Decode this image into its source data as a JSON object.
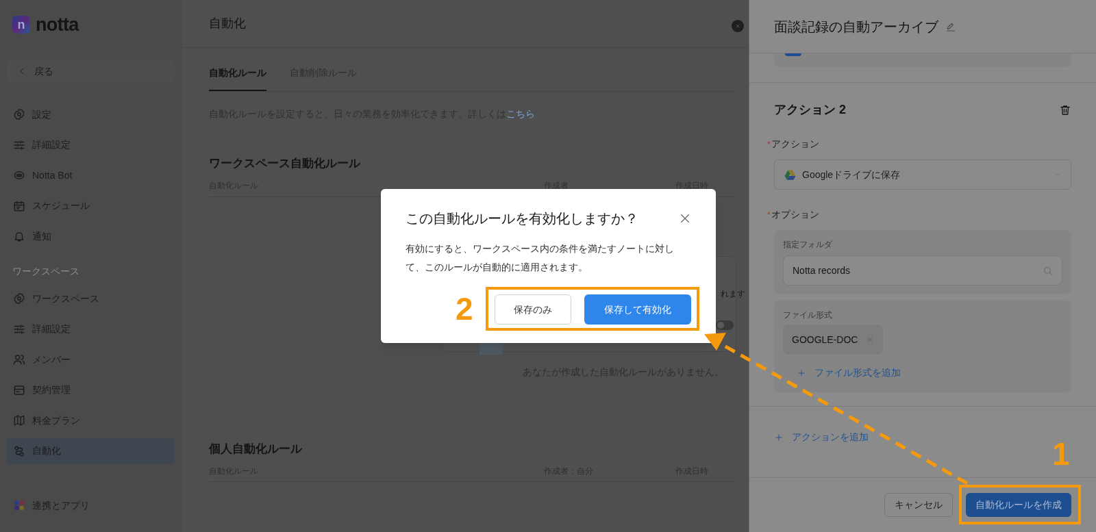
{
  "app": {
    "logo_mark": "n",
    "logo_text": "notta"
  },
  "sidebar": {
    "back": "戻る",
    "items": [
      {
        "label": "設定",
        "kind": "gear",
        "selected": false
      },
      {
        "label": "詳細設定",
        "kind": "sliders",
        "selected": false
      },
      {
        "label": "Notta Bot",
        "kind": "bot",
        "selected": false
      },
      {
        "label": "スケジュール",
        "kind": "calendar",
        "selected": false
      },
      {
        "label": "通知",
        "kind": "bell",
        "selected": false
      }
    ],
    "section": "ワークスペース",
    "workspace_items": [
      {
        "label": "ワークスペース",
        "kind": "gear",
        "selected": false
      },
      {
        "label": "詳細設定",
        "kind": "sliders",
        "selected": false
      },
      {
        "label": "メンバー",
        "kind": "people",
        "selected": false
      },
      {
        "label": "契約管理",
        "kind": "card",
        "selected": false
      },
      {
        "label": "料金プラン",
        "kind": "map",
        "selected": false
      },
      {
        "label": "自動化",
        "kind": "flow",
        "selected": true
      }
    ],
    "bottom": {
      "label": "連携とアプリ"
    }
  },
  "main": {
    "title": "自動化",
    "tabs": [
      {
        "label": "自動化ルール",
        "selected": true
      },
      {
        "label": "自動削除ルール",
        "selected": false
      }
    ],
    "description": "自動化ルールを設定すると、日々の業務を効率化できます。詳しくは",
    "link": "こちら",
    "workspace_rules": {
      "title": "ワークスペース自動化ルール",
      "columns": [
        "自動化ルール",
        "作成者",
        "作成日時"
      ],
      "empty": "あなたが作成した自動化ルールがありません。"
    },
    "background_card": {
      "text": "れます",
      "toggle_on": false
    },
    "personal_rules": {
      "title": "個人自動化ルール",
      "columns": [
        "自動化ルール",
        "作成者：自分",
        "作成日時"
      ]
    }
  },
  "drawer": {
    "title": "面談記録の自動アーカイブ",
    "action": {
      "heading": "アクション 2",
      "action_label": {
        "mark": "*",
        "text": "アクション"
      },
      "action_value": "Googleドライブに保存",
      "option_label": {
        "mark": "*",
        "text": "オプション"
      },
      "folder_label": "指定フォルダ",
      "folder_value": "Notta records",
      "format_label": "ファイル形式",
      "formats": [
        "GOOGLE-DOC"
      ],
      "add_format": "ファイル形式を追加"
    },
    "add_action": "アクションを追加",
    "cancel": "キャンセル",
    "create": "自動化ルールを作成"
  },
  "modal": {
    "title": "この自動化ルールを有効化しますか？",
    "body": "有効にすると、ワークスペース内の条件を満たすノートに対して、このルールが自動的に適用されます。",
    "buttons": [
      {
        "label": "保存のみ",
        "kind": "secondary"
      },
      {
        "label": "保存して有効化",
        "kind": "primary"
      }
    ]
  },
  "annotations": [
    {
      "number": "1"
    },
    {
      "number": "2"
    }
  ]
}
